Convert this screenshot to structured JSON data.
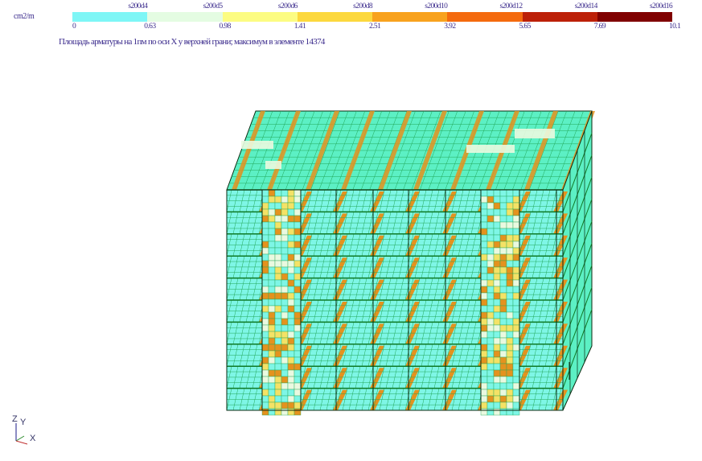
{
  "legend": {
    "unit": "cm2/m",
    "top_labels": [
      "s200d4",
      "s200d5",
      "s200d6",
      "s200d8",
      "s200d10",
      "s200d12",
      "s200d14",
      "s200d16"
    ],
    "bottom_labels": [
      "0",
      "0.63",
      "0.98",
      "1.41",
      "2.51",
      "3.92",
      "5.65",
      "7.69",
      "10.1"
    ],
    "colors": [
      "#7ef6f6",
      "#e4fce2",
      "#fcfc82",
      "#fcd83e",
      "#f8a21e",
      "#f46a0e",
      "#bc2008",
      "#800000"
    ]
  },
  "caption": "Площадь арматуры на 1пм по оси X у верхней грани; максимум в элементе 14374",
  "model": {
    "mesh_colors": {
      "base": "#5cf0c4",
      "alt": "#7ef6e6",
      "light": "#eaf9e0",
      "yellow": "#f4e266",
      "orange": "#e4921e",
      "edge": "#0a2a10",
      "line": "#22a858",
      "floor_edge": "#0e7a26"
    }
  },
  "axes": {
    "z": "Z",
    "y": "Y",
    "x": "X"
  }
}
